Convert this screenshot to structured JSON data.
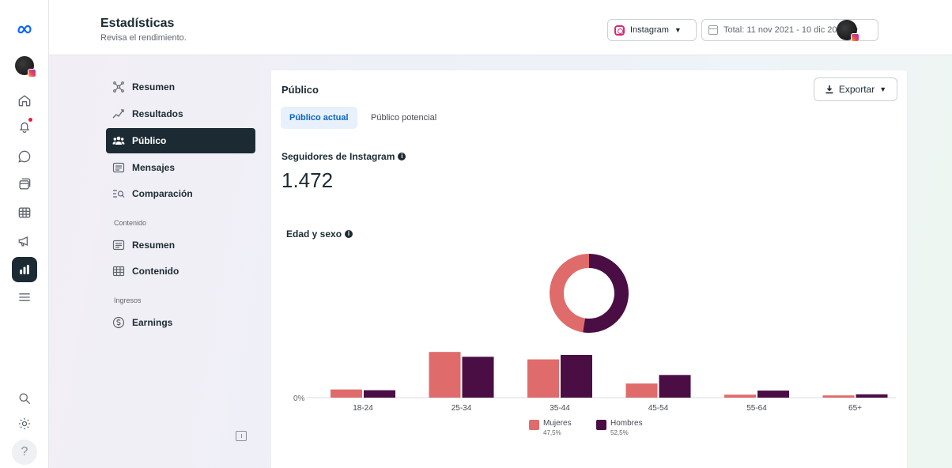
{
  "header": {
    "title": "Estadísticas",
    "subtitle": "Revisa el rendimiento.",
    "account_select": "Instagram",
    "date_range": "Total: 11 nov 2021 - 10 dic 2024"
  },
  "rail": {
    "icons": [
      "meta-logo-icon",
      "home-icon",
      "bell-icon",
      "chat-icon",
      "pages-icon",
      "table-icon",
      "megaphone-icon",
      "insights-icon",
      "menu-icon",
      "search-icon",
      "gear-icon",
      "help-icon"
    ],
    "help_label": "?"
  },
  "nav": {
    "items": [
      {
        "label": "Resumen",
        "icon": "overview-icon"
      },
      {
        "label": "Resultados",
        "icon": "trend-icon"
      },
      {
        "label": "Público",
        "icon": "people-icon"
      },
      {
        "label": "Mensajes",
        "icon": "messages-icon"
      },
      {
        "label": "Comparación",
        "icon": "compare-icon"
      }
    ],
    "section_content": "Contenido",
    "content_items": [
      {
        "label": "Resumen",
        "icon": "content-overview-icon"
      },
      {
        "label": "Contenido",
        "icon": "grid-icon"
      }
    ],
    "section_income": "Ingresos",
    "income_items": [
      {
        "label": "Earnings",
        "icon": "dollar-icon"
      }
    ]
  },
  "main": {
    "title": "Público",
    "export_label": "Exportar",
    "tabs": [
      {
        "label": "Público actual",
        "active": true
      },
      {
        "label": "Público potencial",
        "active": false
      }
    ],
    "followers_label": "Seguidores de Instagram",
    "followers_value": "1.472",
    "chart_title": "Edad y sexo"
  },
  "colors": {
    "women": "#e06b6b",
    "men": "#4a0e45",
    "active_nav": "#1c2b33",
    "active_tab_bg": "#e7f0fb",
    "active_tab_text": "#0a66c2"
  },
  "chart_data": [
    {
      "type": "pie",
      "labels": [
        "Mujeres",
        "Hombres"
      ],
      "values": [
        47.5,
        52.5
      ]
    },
    {
      "type": "bar",
      "categories": [
        "18-24",
        "25-34",
        "35-44",
        "45-54",
        "55-64",
        "65+"
      ],
      "series": [
        {
          "name": "Mujeres",
          "values": [
            2.2,
            12.3,
            10.3,
            3.8,
            0.8,
            0.6
          ]
        },
        {
          "name": "Hombres",
          "values": [
            2.0,
            11.0,
            11.5,
            6.1,
            1.9,
            0.9
          ]
        }
      ],
      "y_tick_label": "0%",
      "legend": [
        {
          "name": "Mujeres",
          "pct": "47,5%"
        },
        {
          "name": "Hombres",
          "pct": "52,5%"
        }
      ]
    }
  ]
}
